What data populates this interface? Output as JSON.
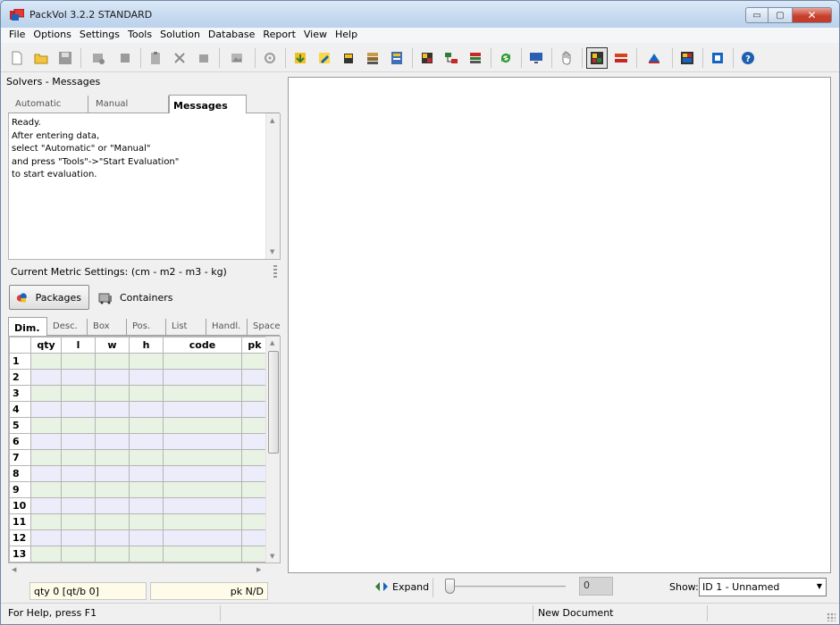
{
  "window": {
    "title": "PackVol 3.2.2 STANDARD",
    "controls": {
      "minimize": "▭",
      "maximize": "▢",
      "close": "✕"
    }
  },
  "menu": [
    "File",
    "Options",
    "Settings",
    "Tools",
    "Solution",
    "Database",
    "Report",
    "View",
    "Help"
  ],
  "solvers": {
    "title": "Solvers - Messages",
    "tabs": [
      "Automatic",
      "Manual",
      "Messages"
    ],
    "active_tab": "Messages",
    "messages": "Ready.\nAfter entering data,\nselect \"Automatic\" or \"Manual\"\nand press \"Tools\"->\"Start Evaluation\"\nto start evaluation."
  },
  "metric": {
    "label": "Current Metric Settings: (cm - m2 - m3 - kg)"
  },
  "item_tabs": {
    "packages": "Packages",
    "containers": "Containers",
    "active": "Packages"
  },
  "package_tabs": [
    "Dim.",
    "Desc.",
    "Box",
    "Pos.",
    "List",
    "Handl.",
    "Space"
  ],
  "grid": {
    "columns": [
      "",
      "qty",
      "l",
      "w",
      "h",
      "code",
      "pk"
    ],
    "rows": [
      "1",
      "2",
      "3",
      "4",
      "5",
      "6",
      "7",
      "8",
      "9",
      "10",
      "11",
      "12",
      "13"
    ]
  },
  "footer": {
    "qty": "qty 0 [qt/b 0]",
    "pk": "pk N/D"
  },
  "viewer": {
    "expand_label": "Expand",
    "slider_value": 0,
    "value_box": "0",
    "show_label": "Show:",
    "show_selected": "ID 1 - Unnamed"
  },
  "status": {
    "help": "For Help, press F1",
    "document": "New Document"
  },
  "toolbar_icons": [
    "new-icon",
    "open-icon",
    "save-icon",
    "print-setup-icon",
    "copy-icon",
    "paste-icon",
    "cut-icon",
    "undo-icon",
    "image-icon",
    "settings-icon",
    "import-icon",
    "edit-icon",
    "database-icon",
    "stack-icon",
    "list-icon",
    "report-icon",
    "tree-icon",
    "layers-icon",
    "refresh-icon",
    "monitor-icon",
    "hand-icon",
    "view-3d-icon",
    "brick-icon",
    "color-icon",
    "grid-icon",
    "fit-icon",
    "help-icon"
  ]
}
